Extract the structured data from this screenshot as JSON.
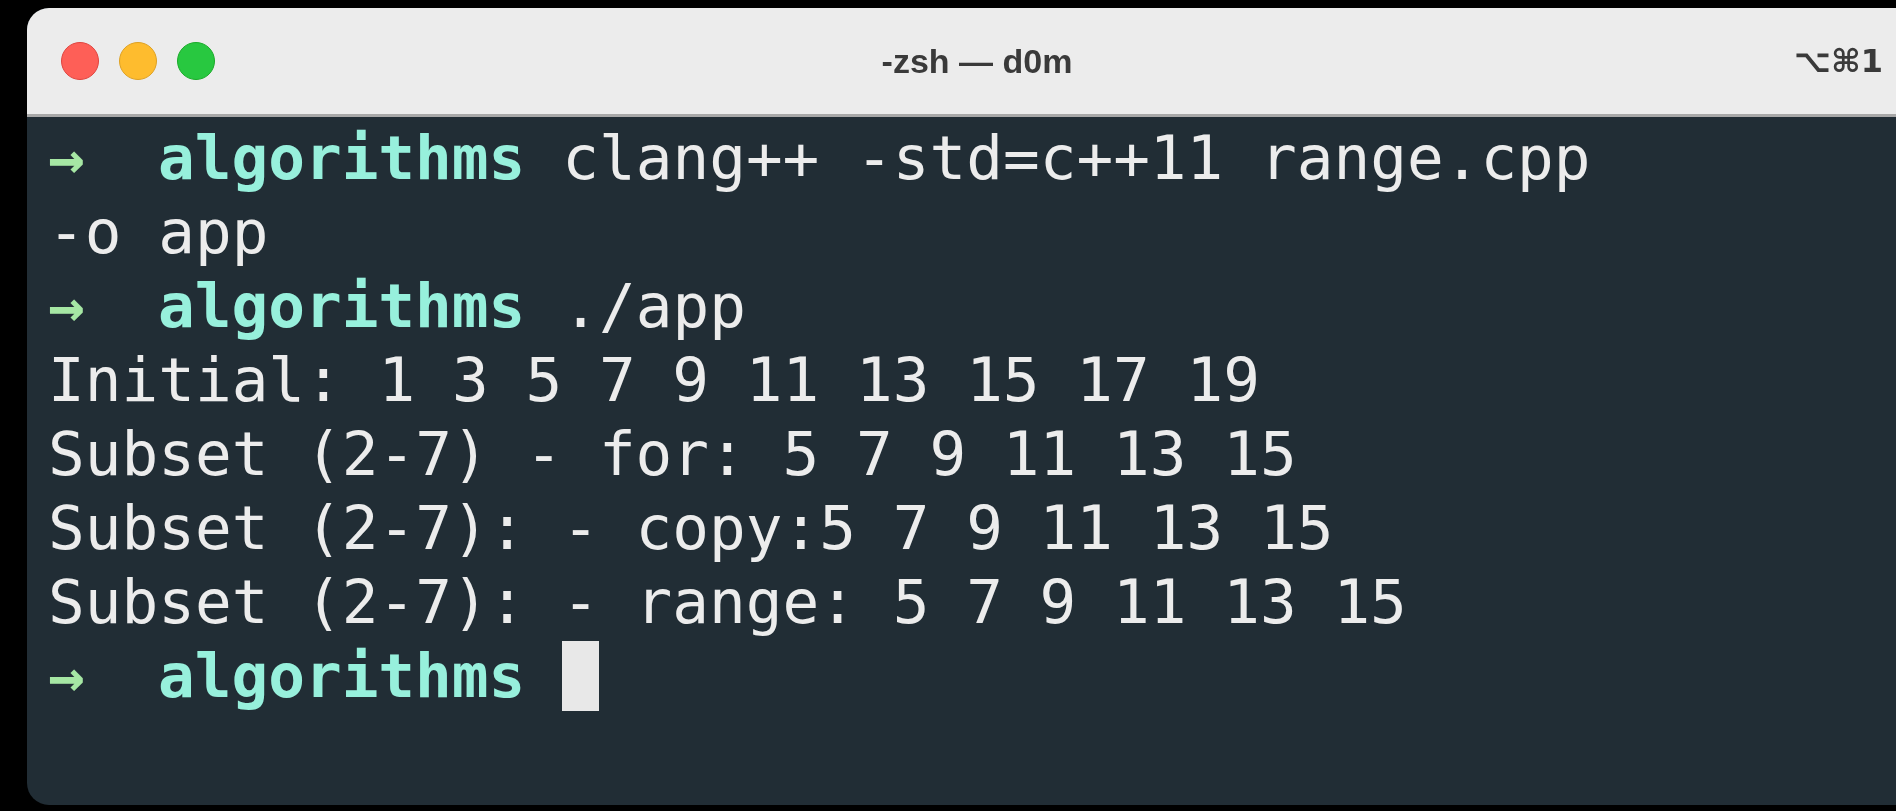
{
  "window": {
    "title": "-zsh — d0m",
    "shortcut": "⌥⌘1"
  },
  "lines": [
    {
      "kind": "prompt",
      "arrow": "→",
      "dir": "algorithms",
      "command": "clang++ -std=c++11 range.cpp"
    },
    {
      "kind": "output",
      "text": "-o app"
    },
    {
      "kind": "prompt",
      "arrow": "→",
      "dir": "algorithms",
      "command": "./app"
    },
    {
      "kind": "output",
      "text": "Initial: 1 3 5 7 9 11 13 15 17 19"
    },
    {
      "kind": "output",
      "text": "Subset (2-7) - for: 5 7 9 11 13 15"
    },
    {
      "kind": "output",
      "text": "Subset (2-7): - copy:5 7 9 11 13 15"
    },
    {
      "kind": "output",
      "text": "Subset (2-7): - range: 5 7 9 11 13 15"
    },
    {
      "kind": "prompt",
      "arrow": "→",
      "dir": "algorithms",
      "cursor": true
    }
  ]
}
